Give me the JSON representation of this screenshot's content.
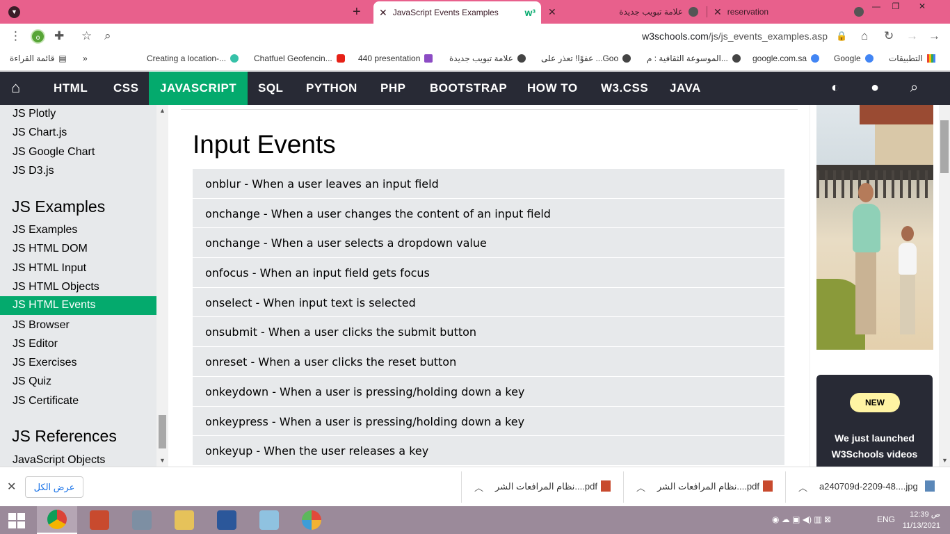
{
  "browser": {
    "tabs": [
      {
        "label": "JavaScript Events Examples",
        "active": true
      },
      {
        "label": "علامة تبويب جديدة",
        "active": false
      },
      {
        "label": "reservation",
        "active": false
      }
    ],
    "url_host": "w3schools.com",
    "url_path": "/js/js_events_examples.asp",
    "profile_initial": "o",
    "bookmarks": [
      {
        "label": "التطبيقات"
      },
      {
        "label": "Google"
      },
      {
        "label": "google.com.sa"
      },
      {
        "label": "الموسوعة الثقافية : م..."
      },
      {
        "label": "عفوًا! تعذر على ...Goo"
      },
      {
        "label": "علامة تبويب جديدة"
      },
      {
        "label": "440 presentation"
      },
      {
        "label": "Chatfuel Geofencin..."
      },
      {
        "label": "Creating a location-..."
      },
      {
        "label": "قائمة القراءة"
      }
    ]
  },
  "w3nav": {
    "items": [
      "HTML",
      "CSS",
      "JAVASCRIPT",
      "SQL",
      "PYTHON",
      "PHP",
      "BOOTSTRAP",
      "HOW TO",
      "W3.CSS",
      "JAVA"
    ],
    "active": "JAVASCRIPT"
  },
  "sidebar": {
    "top_links": [
      "JS Plotly",
      "JS Chart.js",
      "JS Google Chart",
      "JS D3.js"
    ],
    "examples_heading": "JS Examples",
    "example_links": [
      "JS Examples",
      "JS HTML DOM",
      "JS HTML Input",
      "JS HTML Objects",
      "JS HTML Events",
      "JS Browser",
      "JS Editor",
      "JS Exercises",
      "JS Quiz",
      "JS Certificate"
    ],
    "active_link": "JS HTML Events",
    "references_heading": "JS References",
    "reference_links": [
      "JavaScript Objects"
    ]
  },
  "main": {
    "heading": "Input Events",
    "events": [
      "onblur - When a user leaves an input field",
      "onchange - When a user changes the content of an input field",
      "onchange - When a user selects a dropdown value",
      "onfocus - When an input field gets focus",
      "onselect - When input text is selected",
      "onsubmit - When a user clicks the submit button",
      "onreset - When a user clicks the reset button",
      "onkeydown - When a user is pressing/holding down a key",
      "onkeypress - When a user is pressing/holding down a key",
      "onkeyup - When the user releases a key"
    ]
  },
  "ad": {
    "badge": "NEW",
    "line1": "We just launched",
    "line2": "W3Schools videos"
  },
  "downloads": {
    "show_all": "عرض الكل",
    "items": [
      {
        "name": "a240709d-2209-48....jpg"
      },
      {
        "name": "نظام المرافعات الشر....pdf"
      },
      {
        "name": "نظام المرافعات الشر....pdf"
      }
    ]
  },
  "taskbar": {
    "lang": "ENG",
    "time": "12:39 ص",
    "date": "11/13/2021"
  },
  "colors": {
    "w3_green": "#04aa6d",
    "w3_dark": "#282a35",
    "tabbar_pink": "#e8608c",
    "sidebar_gray": "#e7e9eb"
  }
}
